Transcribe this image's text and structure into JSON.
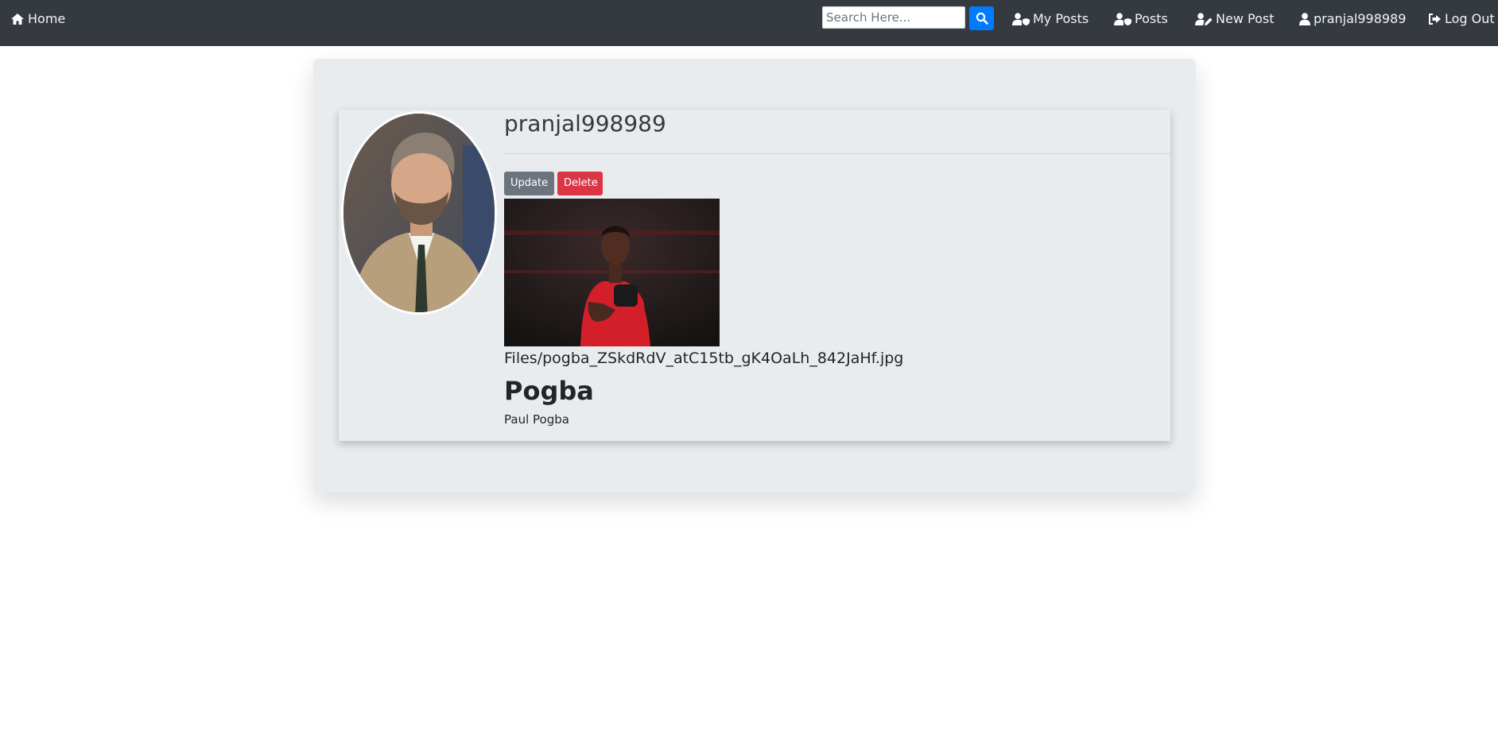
{
  "navbar": {
    "home_label": "Home",
    "search_placeholder": "Search Here...",
    "search_value": "",
    "my_posts_label": "My Posts",
    "posts_label": "Posts",
    "new_post_label": "New Post",
    "user_label": "pranjal998989",
    "logout_label": "Log Out",
    "icons": {
      "home": "home-icon",
      "search": "search-icon",
      "my_posts": "user-shield-icon",
      "posts": "user-shield-icon",
      "new_post": "user-edit-icon",
      "user": "user-icon",
      "logout": "sign-out-icon"
    }
  },
  "profile": {
    "username": "pranjal998989",
    "avatar_alt": "profile-photo"
  },
  "actions": {
    "update_label": "Update",
    "delete_label": "Delete"
  },
  "post": {
    "image_alt": "post-photo",
    "file_path": "Files/pogba_ZSkdRdV_atC15tb_gK4OaLh_842JaHf.jpg",
    "title": "Pogba",
    "body": "Paul Pogba"
  },
  "colors": {
    "navbar_bg": "#343a40",
    "search_button": "#007bff",
    "update_button": "#6c757d",
    "delete_button": "#dc3545",
    "jumbotron_bg": "#e9ecef"
  }
}
